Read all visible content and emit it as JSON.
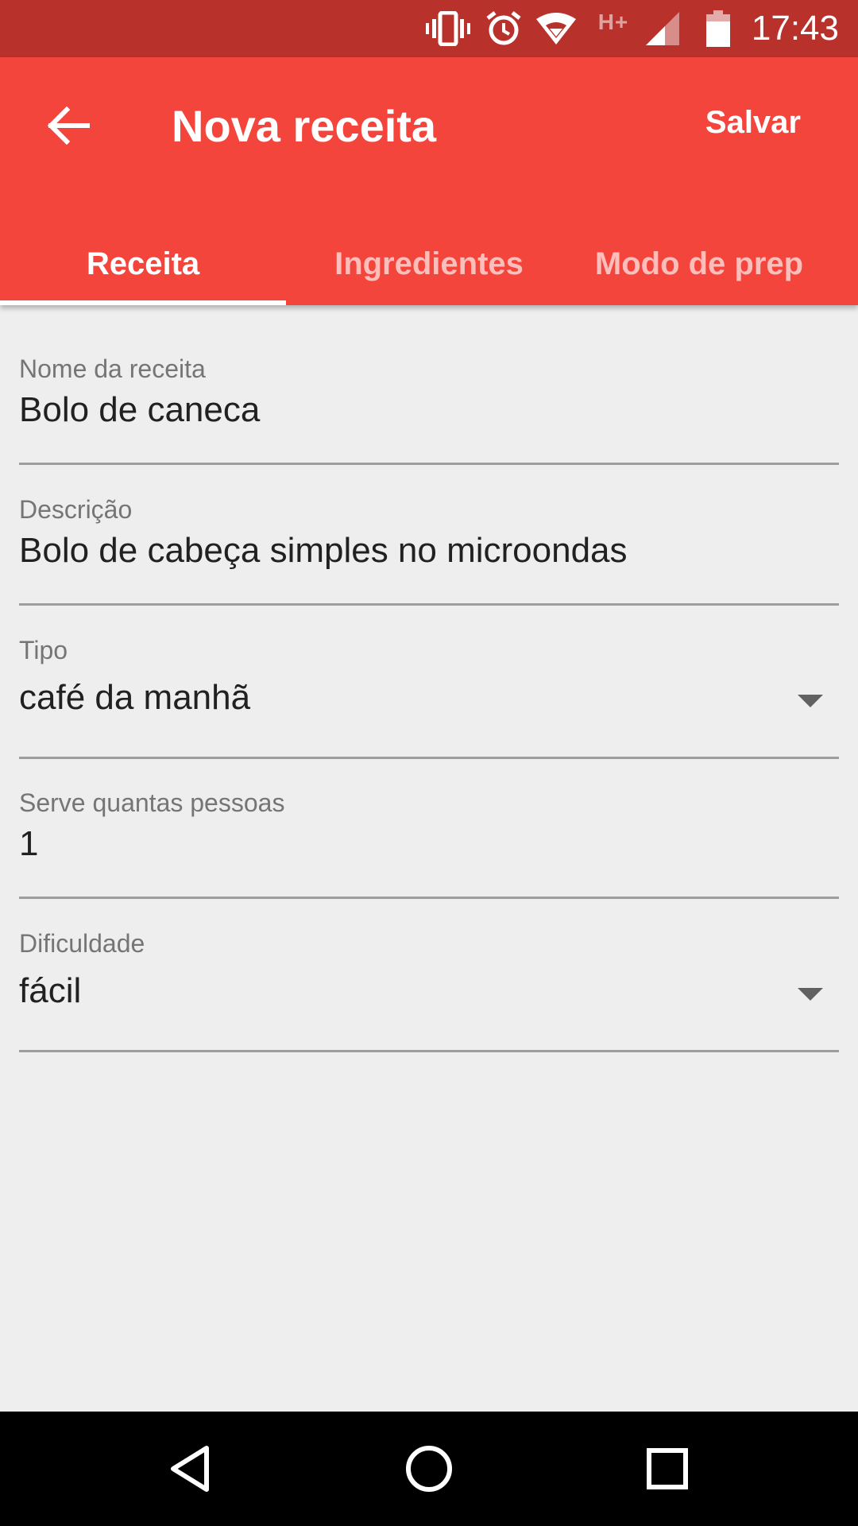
{
  "status_bar": {
    "time": "17:43",
    "network_label": "H+",
    "icons": [
      "vibrate-icon",
      "alarm-icon",
      "wifi-icon",
      "signal-icon",
      "battery-icon"
    ]
  },
  "app_bar": {
    "title": "Nova receita",
    "save_label": "Salvar",
    "back_icon": "arrow-back-icon",
    "background_color": "#f4453c",
    "status_color": "#b8312b"
  },
  "tabs": [
    {
      "label": "Receita",
      "active": true
    },
    {
      "label": "Ingredientes",
      "active": false
    },
    {
      "label": "Modo de prep",
      "active": false
    }
  ],
  "form": {
    "name": {
      "label": "Nome da receita",
      "value": "Bolo de caneca"
    },
    "description": {
      "label": "Descrição",
      "value": "Bolo de cabeça simples no microondas"
    },
    "type": {
      "label": "Tipo",
      "value": "café da manhã"
    },
    "servings": {
      "label": "Serve quantas pessoas",
      "value": "1"
    },
    "difficulty": {
      "label": "Dificuldade",
      "value": "fácil"
    }
  },
  "nav_bar": {
    "icons": [
      "back-triangle-icon",
      "home-circle-icon",
      "recents-square-icon"
    ]
  }
}
